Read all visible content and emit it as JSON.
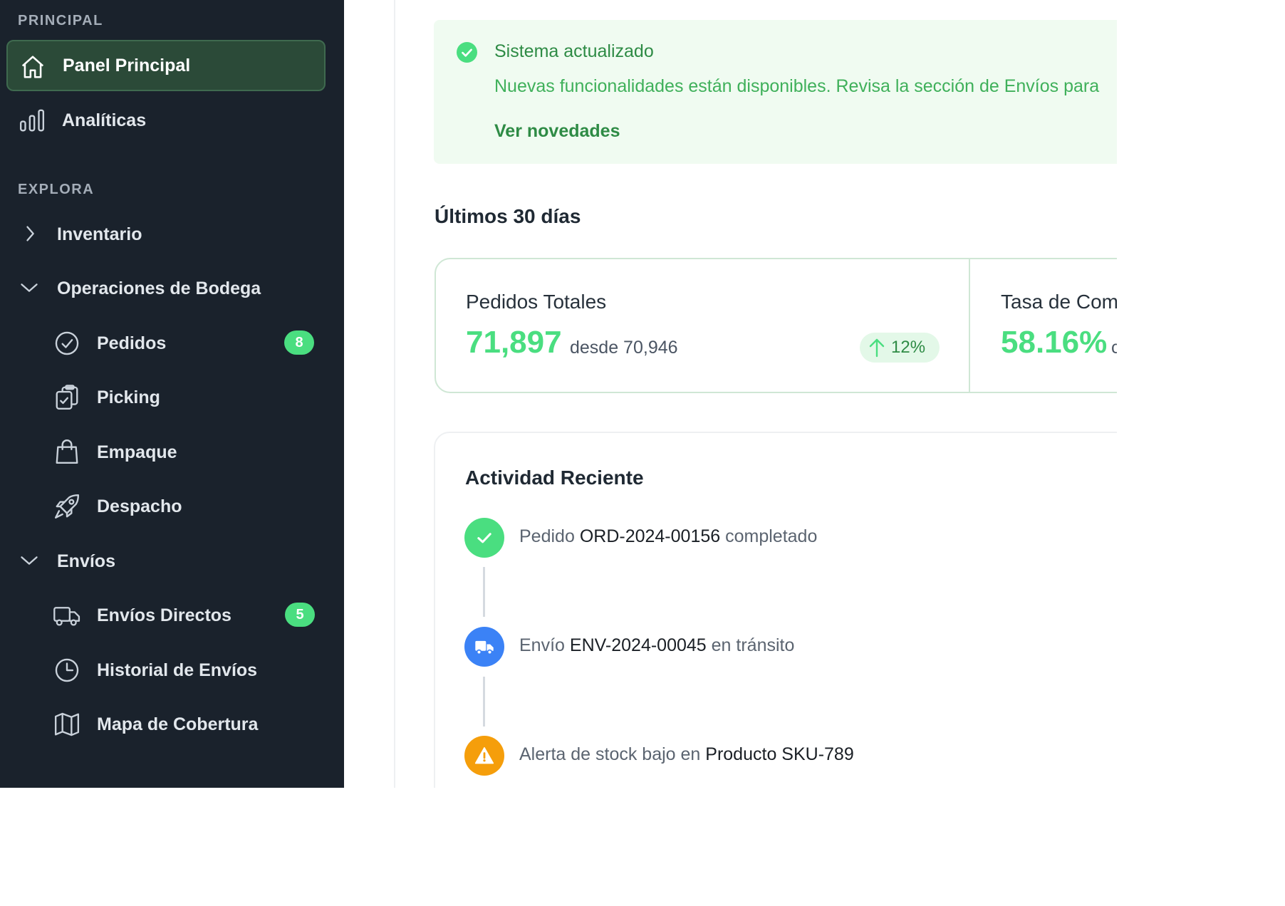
{
  "sidebar": {
    "sections": {
      "principal": "PRINCIPAL",
      "explora": "EXPLORA"
    },
    "items": {
      "panel": "Panel Principal",
      "analiticas": "Analíticas",
      "inventario": "Inventario",
      "operaciones": "Operaciones de Bodega",
      "pedidos": "Pedidos",
      "picking": "Picking",
      "empaque": "Empaque",
      "despacho": "Despacho",
      "envios": "Envíos",
      "envios_directos": "Envíos Directos",
      "historial": "Historial de Envíos",
      "mapa": "Mapa de Cobertura"
    },
    "badges": {
      "pedidos": "8",
      "envios_directos": "5"
    }
  },
  "alert": {
    "title": "Sistema actualizado",
    "body": "Nuevas funcionalidades están disponibles. Revisa la sección de Envíos para",
    "link": "Ver novedades"
  },
  "stats": {
    "period": "Últimos 30 días",
    "cards": [
      {
        "name": "Pedidos Totales",
        "value": "71,897",
        "from": "desde 70,946",
        "change": "12%"
      },
      {
        "name": "Tasa de Com",
        "value": "58.16%",
        "from": "c"
      }
    ]
  },
  "activity": {
    "title": "Actividad Reciente",
    "items": [
      {
        "pre": "Pedido",
        "ref": "ORD-2024-00156",
        "post": "completado"
      },
      {
        "pre": "Envío",
        "ref": "ENV-2024-00045",
        "post": "en tránsito"
      },
      {
        "pre": "Alerta de stock bajo en",
        "ref": "Producto SKU-789",
        "post": ""
      }
    ]
  },
  "colors": {
    "sidebar_bg": "#1a222c",
    "active_bg": "#2b4a38",
    "accent_green": "#4ade80",
    "info_blue": "#3b82f6",
    "warning_orange": "#f59e0b"
  }
}
